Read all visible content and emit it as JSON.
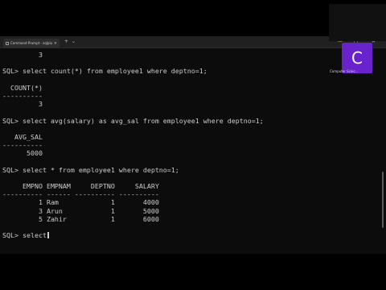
{
  "window": {
    "tab_title": "Command Prompt - sqlplus",
    "tab_close": "×",
    "new_tab": "+",
    "dropdown": "⌄",
    "minimize": "—",
    "maximize": "□",
    "close": "✕"
  },
  "terminal": {
    "lines": [
      "         3",
      "",
      "SQL> select count(*) from employee1 where deptno=1;",
      "",
      "  COUNT(*)",
      "----------",
      "         3",
      "",
      "SQL> select avg(salary) as avg_sal from employee1 where deptno=1;",
      "",
      "   AVG_SAL",
      "----------",
      "      5000",
      "",
      "SQL> select * from employee1 where deptno=1;",
      "",
      "     EMPNO EMPNAM     DEPTNO     SALARY",
      "---------- ------ ---------- ----------",
      "         1 Ram             1       4000",
      "         3 Arun            1       5000",
      "         5 Zahir           1       6000",
      "",
      "SQL> select"
    ]
  },
  "presenter": {
    "initial": "C",
    "label": "Computer Sciec..."
  }
}
